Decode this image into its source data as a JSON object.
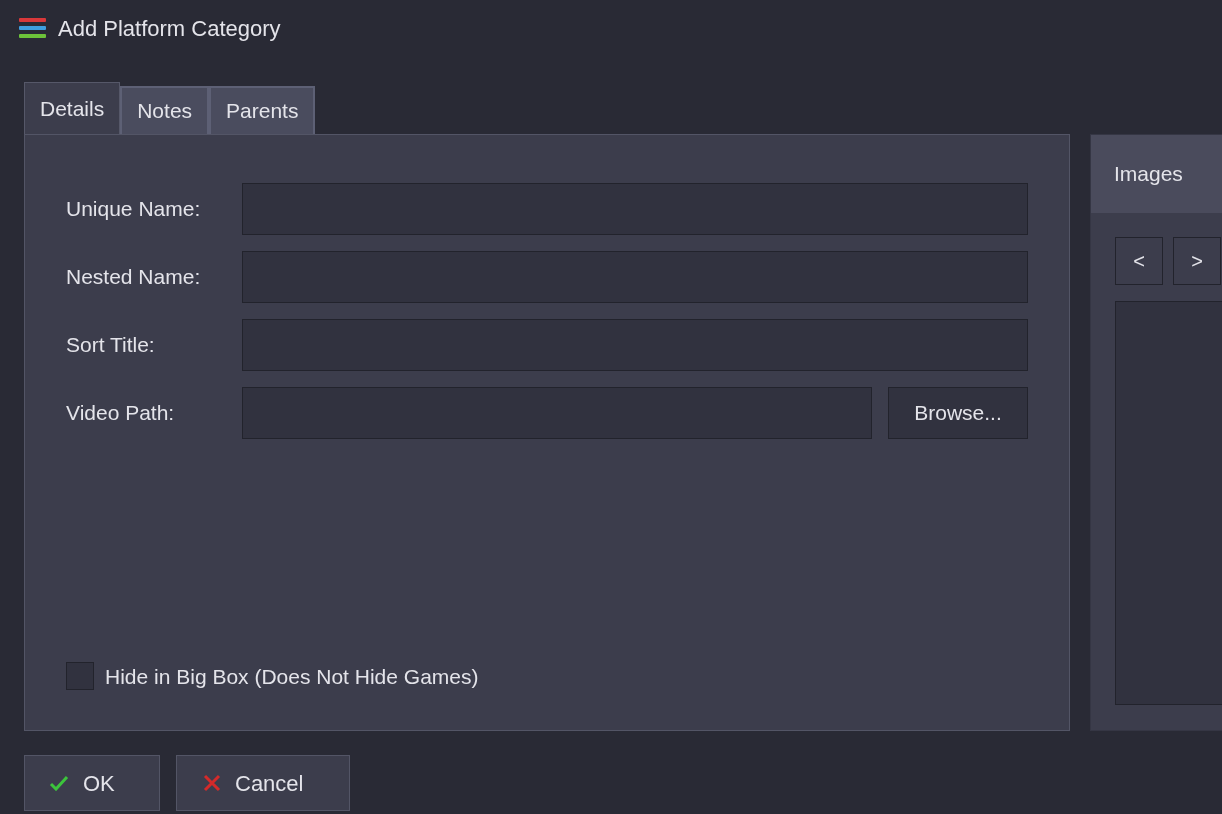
{
  "window": {
    "title": "Add Platform Category"
  },
  "tabs": [
    {
      "label": "Details",
      "selected": true
    },
    {
      "label": "Notes",
      "selected": false
    },
    {
      "label": "Parents",
      "selected": false
    }
  ],
  "fields": [
    {
      "label": "Unique Name:",
      "kind": "text"
    },
    {
      "label": "Nested Name:",
      "kind": "text"
    },
    {
      "label": "Sort Title:",
      "kind": "text"
    },
    {
      "label": "Video Path:",
      "kind": "browse",
      "button": "Browse..."
    }
  ],
  "checkbox": {
    "label": "Hide in Big Box (Does Not Hide Games)",
    "checked": false
  },
  "images_panel": {
    "title": "Images",
    "nav": [
      {
        "label": "<"
      },
      {
        "label": ">"
      }
    ]
  },
  "buttons": [
    {
      "label": "OK",
      "kind": "ok"
    },
    {
      "label": "Cancel",
      "kind": "cancel"
    }
  ]
}
